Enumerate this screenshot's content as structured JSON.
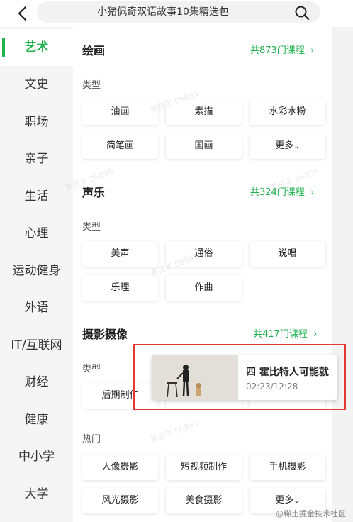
{
  "header": {
    "search_text": "小猪佩奇双语故事10集精选包"
  },
  "sidebar": {
    "items": [
      {
        "label": "艺术"
      },
      {
        "label": "文史"
      },
      {
        "label": "职场"
      },
      {
        "label": "亲子"
      },
      {
        "label": "生活"
      },
      {
        "label": "心理"
      },
      {
        "label": "运动健身"
      },
      {
        "label": "外语"
      },
      {
        "label": "IT/互联网"
      },
      {
        "label": "财经"
      },
      {
        "label": "健康"
      },
      {
        "label": "中小学"
      },
      {
        "label": "大学"
      }
    ]
  },
  "sections": {
    "painting": {
      "title": "绘画",
      "link": "共873门课程",
      "type_label": "类型",
      "chips": [
        "油画",
        "素描",
        "水彩水粉",
        "简笔画",
        "国画",
        "更多"
      ]
    },
    "vocal": {
      "title": "声乐",
      "link": "共324门课程",
      "type_label": "类型",
      "chips": [
        "美声",
        "通俗",
        "说唱",
        "乐理",
        "作曲"
      ]
    },
    "photo": {
      "title": "摄影摄像",
      "link": "共417门课程",
      "type_label": "类型",
      "type_chips": [
        "后期制作"
      ],
      "hot_label": "热门",
      "hot_chips": [
        "人像摄影",
        "短视频制作",
        "手机摄影",
        "风光摄影",
        "美食摄影",
        "更多"
      ]
    }
  },
  "floating_video": {
    "title": "四 霍比特人可能就",
    "time": "02:23/12:28"
  },
  "footer": {
    "watermark": "@稀土掘金技术社区"
  },
  "colors": {
    "accent": "#21b14f",
    "highlight_border": "#e53935"
  }
}
